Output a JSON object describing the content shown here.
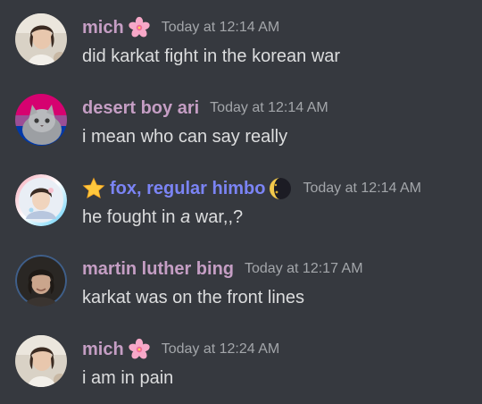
{
  "colors": {
    "background": "#36393f",
    "text": "#dcddde",
    "timestamp": "#a3a6aa",
    "name_pink": "#c59ec4",
    "name_blue": "#7b84f5"
  },
  "messages": [
    {
      "username": "mich",
      "name_emoji_after": "cherry-blossom-icon",
      "timestamp": "Today at 12:14 AM",
      "text": "did karkat fight in the korean war"
    },
    {
      "username": "desert boy ari",
      "timestamp": "Today at 12:14 AM",
      "text": "i mean who can say really"
    },
    {
      "username": "fox, regular himbo",
      "name_emoji_before": "star-icon",
      "name_emoji_after": "waning-crescent-moon-icon",
      "timestamp": "Today at 12:14 AM",
      "text_before": "he fought in ",
      "text_italic": "a",
      "text_after": " war,,?"
    },
    {
      "username": "martin luther bing",
      "timestamp": "Today at 12:17 AM",
      "text": "karkat was on the front lines"
    },
    {
      "username": "mich",
      "name_emoji_after": "cherry-blossom-icon",
      "timestamp": "Today at 12:24 AM",
      "text": "i am in pain"
    }
  ]
}
